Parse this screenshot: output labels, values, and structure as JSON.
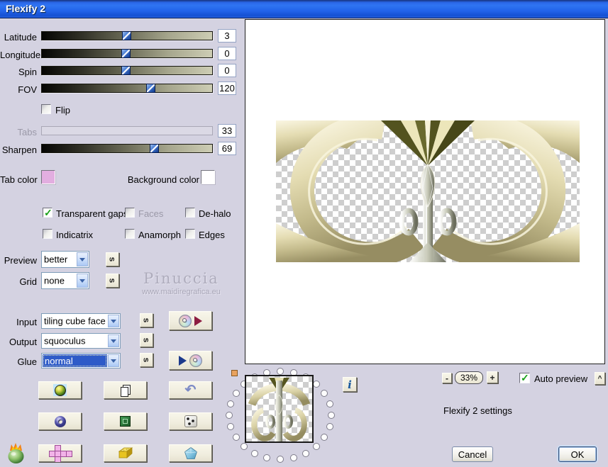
{
  "title": "Flexify 2",
  "sliders": {
    "latitude": {
      "label": "Latitude",
      "value": "3",
      "pos": 0.5
    },
    "longitude": {
      "label": "Longitude",
      "value": "0",
      "pos": 0.49
    },
    "spin": {
      "label": "Spin",
      "value": "0",
      "pos": 0.49
    },
    "fov": {
      "label": "FOV",
      "value": "120",
      "pos": 0.645
    },
    "tabs": {
      "label": "Tabs",
      "value": "33",
      "disabled": true
    },
    "sharpen": {
      "label": "Sharpen",
      "value": "69",
      "pos": 0.67
    }
  },
  "checkboxes": {
    "flip": {
      "label": "Flip",
      "checked": false
    },
    "transparent_gaps": {
      "label": "Transparent gaps",
      "checked": true
    },
    "faces": {
      "label": "Faces",
      "checked": false,
      "disabled": true
    },
    "dehalo": {
      "label": "De-halo",
      "checked": false
    },
    "indicatrix": {
      "label": "Indicatrix",
      "checked": false
    },
    "anamorph": {
      "label": "Anamorph",
      "checked": false
    },
    "edges": {
      "label": "Edges",
      "checked": false
    },
    "auto_preview": {
      "label": "Auto preview",
      "checked": true
    }
  },
  "color_pickers": {
    "tab": {
      "label": "Tab color",
      "color": "#e2aee0"
    },
    "background": {
      "label": "Background color",
      "color": "#ffffff"
    }
  },
  "combos": {
    "preview": {
      "label": "Preview",
      "value": "better"
    },
    "grid": {
      "label": "Grid",
      "value": "none"
    },
    "input": {
      "label": "Input",
      "value": "tiling cube face"
    },
    "output": {
      "label": "Output",
      "value": "squoculus"
    },
    "glue": {
      "label": "Glue",
      "value": "normal",
      "selected": true
    }
  },
  "labels": {
    "s": "s",
    "info": "i",
    "collapse": "^",
    "settings": "Flexify 2 settings"
  },
  "zoom": {
    "minus": "-",
    "level": "33%",
    "plus": "+"
  },
  "watermark": {
    "name": "Pinuccia",
    "url": "www.maidiregrafica.eu"
  },
  "actions": {
    "cancel": "Cancel",
    "ok": "OK"
  }
}
